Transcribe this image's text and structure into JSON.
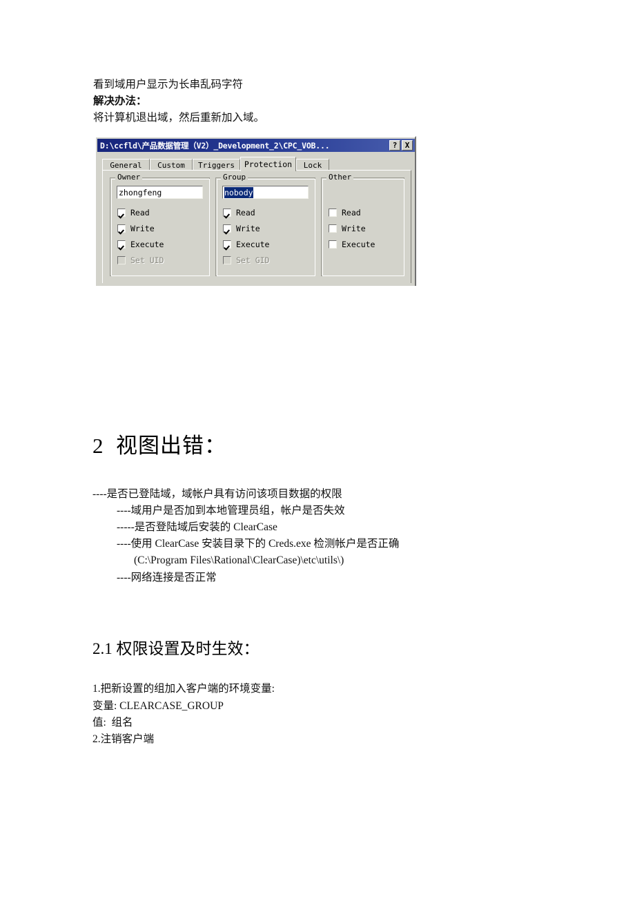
{
  "document": {
    "intro_lines": [
      {
        "text": "看到域用户显示为长串乱码字符",
        "bold": false
      },
      {
        "text": "解决办法：",
        "bold": true
      },
      {
        "text": "将计算机退出域，然后重新加入域。",
        "bold": false
      }
    ],
    "heading_2": "2  视图出错：",
    "bullets": [
      "----是否已登陆域，域帐户具有访问该项目数据的权限",
      "----域用户是否加到本地管理员组，帐户是否失效",
      "-----是否登陆域后安装的 ClearCase",
      "----使用 ClearCase 安装目录下的 Creds.exe 检测帐户是否正确",
      "(C:\\Program Files\\Rational\\ClearCase)\\etc\\utils\\)",
      "----网络连接是否正常"
    ],
    "heading_2_1": "2.1 权限设置及时生效：",
    "steps": [
      "1.把新设置的组加入客户端的环境变量:",
      "变量: CLEARCASE_GROUP",
      "值:  组名",
      "2.注销客户端"
    ]
  },
  "dialog": {
    "title": "D:\\ccfld\\产品数据管理（V2）_Development_2\\CPC_VOB...",
    "help_button": "?",
    "close_button": "X",
    "tabs": [
      {
        "label": "General",
        "active": false
      },
      {
        "label": "Custom",
        "active": false
      },
      {
        "label": "Triggers",
        "active": false
      },
      {
        "label": "Protection",
        "active": true
      },
      {
        "label": "Lock",
        "active": false
      }
    ],
    "groups": [
      {
        "legend": "Owner",
        "field_value": "zhongfeng",
        "field_selected": false,
        "checks": [
          {
            "label": "Read",
            "checked": true,
            "disabled": false
          },
          {
            "label": "Write",
            "checked": true,
            "disabled": false
          },
          {
            "label": "Execute",
            "checked": true,
            "disabled": false
          },
          {
            "label": "Set UID",
            "checked": false,
            "disabled": true
          }
        ]
      },
      {
        "legend": "Group",
        "field_value": "nobody",
        "field_selected": true,
        "checks": [
          {
            "label": "Read",
            "checked": true,
            "disabled": false
          },
          {
            "label": "Write",
            "checked": true,
            "disabled": false
          },
          {
            "label": "Execute",
            "checked": true,
            "disabled": false
          },
          {
            "label": "Set GID",
            "checked": false,
            "disabled": true
          }
        ]
      },
      {
        "legend": "Other",
        "field_value": null,
        "field_selected": false,
        "checks": [
          {
            "label": "Read",
            "checked": false,
            "disabled": false
          },
          {
            "label": "Write",
            "checked": false,
            "disabled": false
          },
          {
            "label": "Execute",
            "checked": false,
            "disabled": false
          }
        ]
      }
    ],
    "colors": {
      "titlebar": "#17267c",
      "face": "#d3d3cb",
      "selection": "#0b2a78"
    }
  }
}
